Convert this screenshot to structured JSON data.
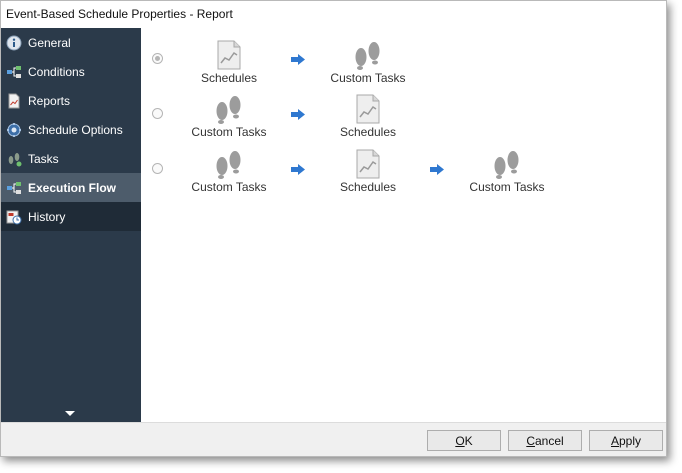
{
  "window": {
    "title": "Event-Based Schedule Properties - Report"
  },
  "sidebar": {
    "items": [
      {
        "label": "General",
        "icon": "info-icon",
        "active": false
      },
      {
        "label": "Conditions",
        "icon": "conditions-icon",
        "active": false
      },
      {
        "label": "Reports",
        "icon": "report-icon",
        "active": false
      },
      {
        "label": "Schedule Options",
        "icon": "schedule-options-icon",
        "active": false
      },
      {
        "label": "Tasks",
        "icon": "footprints-icon",
        "active": false
      },
      {
        "label": "Execution Flow",
        "icon": "execution-flow-icon",
        "active": true
      },
      {
        "label": "History",
        "icon": "history-icon",
        "active": false
      }
    ]
  },
  "flow": {
    "options": [
      {
        "selected": true,
        "steps": [
          "Schedules",
          "Custom Tasks"
        ]
      },
      {
        "selected": false,
        "steps": [
          "Custom Tasks",
          "Schedules"
        ]
      },
      {
        "selected": false,
        "steps": [
          "Custom Tasks",
          "Schedules",
          "Custom Tasks"
        ]
      }
    ]
  },
  "buttons": {
    "ok": {
      "accel": "O",
      "rest": "K"
    },
    "cancel": {
      "accel": "C",
      "rest": "ancel"
    },
    "apply": {
      "accel": "A",
      "rest": "pply"
    }
  },
  "colors": {
    "sidebar_bg": "#2b3a4a",
    "active_item": "#4d5c6b",
    "arrow_blue": "#2f78d0"
  }
}
